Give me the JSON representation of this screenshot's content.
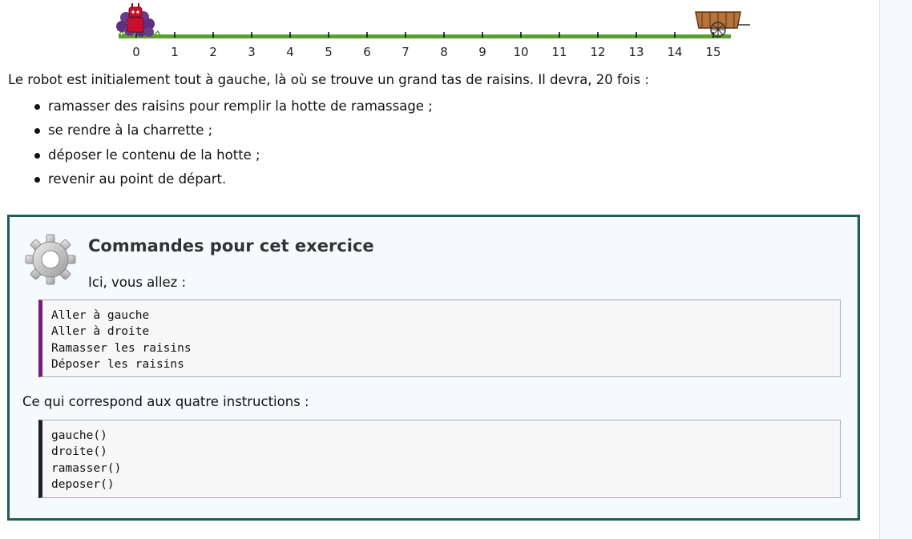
{
  "illustration": {
    "ticks": [
      "0",
      "1",
      "2",
      "3",
      "4",
      "5",
      "6",
      "7",
      "8",
      "9",
      "10",
      "11",
      "12",
      "13",
      "14",
      "15"
    ],
    "robot_icon": "robot-on-grapes-icon",
    "cart_icon": "cart-icon",
    "colors": {
      "grass": "#5aa02c",
      "cart": "#b5743a",
      "grapes": "#6a3b8e",
      "robot": "#c8102e"
    }
  },
  "intro": "Le robot est initialement tout à gauche, là où se trouve un grand tas de raisins. Il devra, 20 fois :",
  "steps": [
    "ramasser des raisins pour remplir la hotte de ramassage ;",
    "se rendre à la charrette ;",
    "déposer le contenu de la hotte ;",
    "revenir au point de départ."
  ],
  "box": {
    "icon": "gear-icon",
    "title": "Commandes pour cet exercice",
    "intro": "Ici, vous allez :",
    "commands": [
      "Aller à gauche",
      "Aller à droite",
      "Ramasser les raisins",
      "Déposer les raisins"
    ],
    "middle": "Ce qui correspond aux quatre instructions :",
    "instructions": [
      "gauche()",
      "droite()",
      "ramasser()",
      "deposer()"
    ],
    "colors": {
      "border": "#1d5e5a",
      "background": "#f5fbfd",
      "commands_accent": "#7a1b7c",
      "instructions_accent": "#1f1f1f"
    }
  }
}
